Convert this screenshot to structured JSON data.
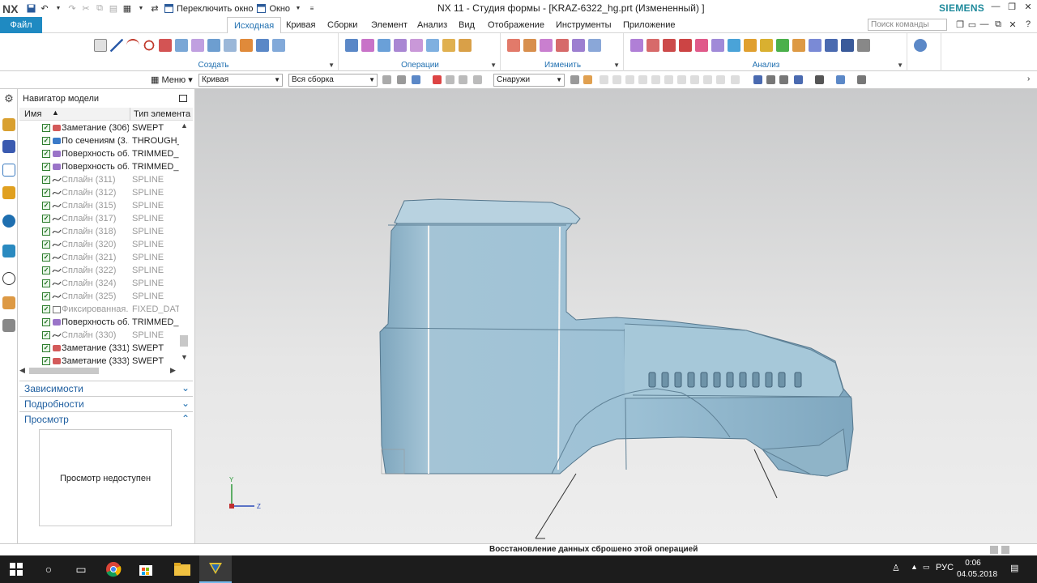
{
  "titlebar": {
    "logo": "NX",
    "switch_window": "Переключить окно",
    "window_menu": "Окно",
    "title": "NX 11 - Студия формы - [KRAZ-6322_hg.prt (Измененный) ]",
    "brand": "SIEMENS"
  },
  "tabs": {
    "file": "Файл",
    "items": [
      "Исходная",
      "Кривая",
      "Сборки",
      "Элемент",
      "Анализ",
      "Вид",
      "Отображение",
      "Инструменты",
      "Приложение"
    ],
    "search_placeholder": "Поиск команды"
  },
  "ribbon": {
    "groups": [
      "Создать",
      "Операции",
      "Изменить",
      "Анализ"
    ]
  },
  "selection_bar": {
    "menu": "Меню",
    "filter": "Кривая",
    "scope": "Вся сборка",
    "snap": "Снаружи"
  },
  "navigator": {
    "title": "Навигатор модели",
    "col_name": "Имя",
    "col_type": "Тип элемента",
    "rows": [
      {
        "name": "Заметание (306)",
        "type": "SWEPT",
        "dim": false,
        "icon": "swept-icon"
      },
      {
        "name": "По сечениям (3...",
        "type": "THROUGH_C",
        "dim": false,
        "icon": "through-curves-icon"
      },
      {
        "name": "Поверхность об...",
        "type": "TRIMMED_SH",
        "dim": false,
        "icon": "trimmed-surface-icon"
      },
      {
        "name": "Поверхность об...",
        "type": "TRIMMED_SH",
        "dim": false,
        "icon": "trimmed-surface-icon"
      },
      {
        "name": "Сплайн (311)",
        "type": "SPLINE",
        "dim": true,
        "icon": "spline-icon"
      },
      {
        "name": "Сплайн (312)",
        "type": "SPLINE",
        "dim": true,
        "icon": "spline-icon"
      },
      {
        "name": "Сплайн (315)",
        "type": "SPLINE",
        "dim": true,
        "icon": "spline-icon"
      },
      {
        "name": "Сплайн (317)",
        "type": "SPLINE",
        "dim": true,
        "icon": "spline-icon"
      },
      {
        "name": "Сплайн (318)",
        "type": "SPLINE",
        "dim": true,
        "icon": "spline-icon"
      },
      {
        "name": "Сплайн (320)",
        "type": "SPLINE",
        "dim": true,
        "icon": "spline-icon"
      },
      {
        "name": "Сплайн (321)",
        "type": "SPLINE",
        "dim": true,
        "icon": "spline-icon"
      },
      {
        "name": "Сплайн (322)",
        "type": "SPLINE",
        "dim": true,
        "icon": "spline-icon"
      },
      {
        "name": "Сплайн (324)",
        "type": "SPLINE",
        "dim": true,
        "icon": "spline-icon"
      },
      {
        "name": "Сплайн (325)",
        "type": "SPLINE",
        "dim": true,
        "icon": "spline-icon"
      },
      {
        "name": "Фиксированная...",
        "type": "FIXED_DATUI",
        "dim": true,
        "icon": "datum-plane-icon"
      },
      {
        "name": "Поверхность об...",
        "type": "TRIMMED_SH",
        "dim": false,
        "icon": "trimmed-surface-icon"
      },
      {
        "name": "Сплайн (330)",
        "type": "SPLINE",
        "dim": true,
        "icon": "spline-icon"
      },
      {
        "name": "Заметание (331)",
        "type": "SWEPT",
        "dim": false,
        "icon": "swept-icon"
      },
      {
        "name": "Заметание (333)",
        "type": "SWEPT",
        "dim": false,
        "icon": "swept-icon"
      }
    ],
    "panels": [
      "Зависимости",
      "Подробности",
      "Просмотр"
    ],
    "preview_text": "Просмотр недоступен"
  },
  "status": {
    "message": "Восстановление данных сброшено этой операцией"
  },
  "triad": {
    "y": "Y",
    "z": "Z"
  },
  "taskbar": {
    "lang": "РУС",
    "time": "0:06",
    "date": "04.05.2018"
  },
  "colors": {
    "accent": "#1f8ac2",
    "model_body": "#9ec2d6"
  }
}
